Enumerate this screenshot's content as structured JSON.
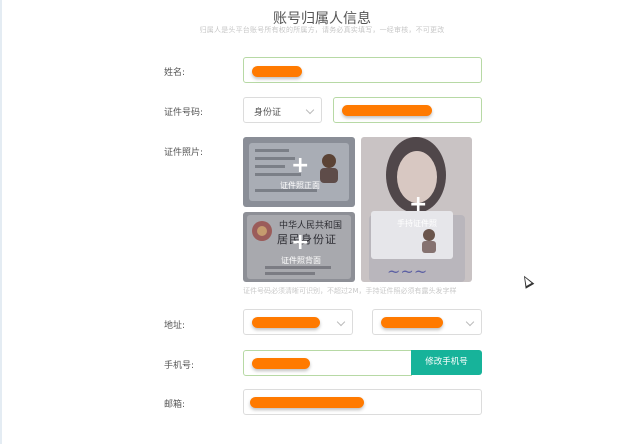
{
  "header": {
    "title": "账号归属人信息",
    "subtitle": "归属人是头平台账号所有权的所属方，请务必真实填写，一经审核，不可更改"
  },
  "form": {
    "name_label": "姓名:",
    "id_label": "证件号码:",
    "id_type": "身份证",
    "photo_label": "证件照片:",
    "front_caption": "证件照正面",
    "back_caption": "证件照背面",
    "handheld_caption": "手持证件照",
    "id_card_title_line1": "中华人民共和国",
    "id_card_title_line2": "居民身份证",
    "photo_hint": "证件号码必须清晰可识别，不超过2M，手持证件照必须有露头发字样",
    "address_label": "地址:",
    "phone_label": "手机号:",
    "change_phone_button": "修改手机号",
    "email_label": "邮箱:"
  },
  "colors": {
    "accent": "#17b39a",
    "redaction": "#ff7a00",
    "border_focus": "#b7d9a5"
  }
}
